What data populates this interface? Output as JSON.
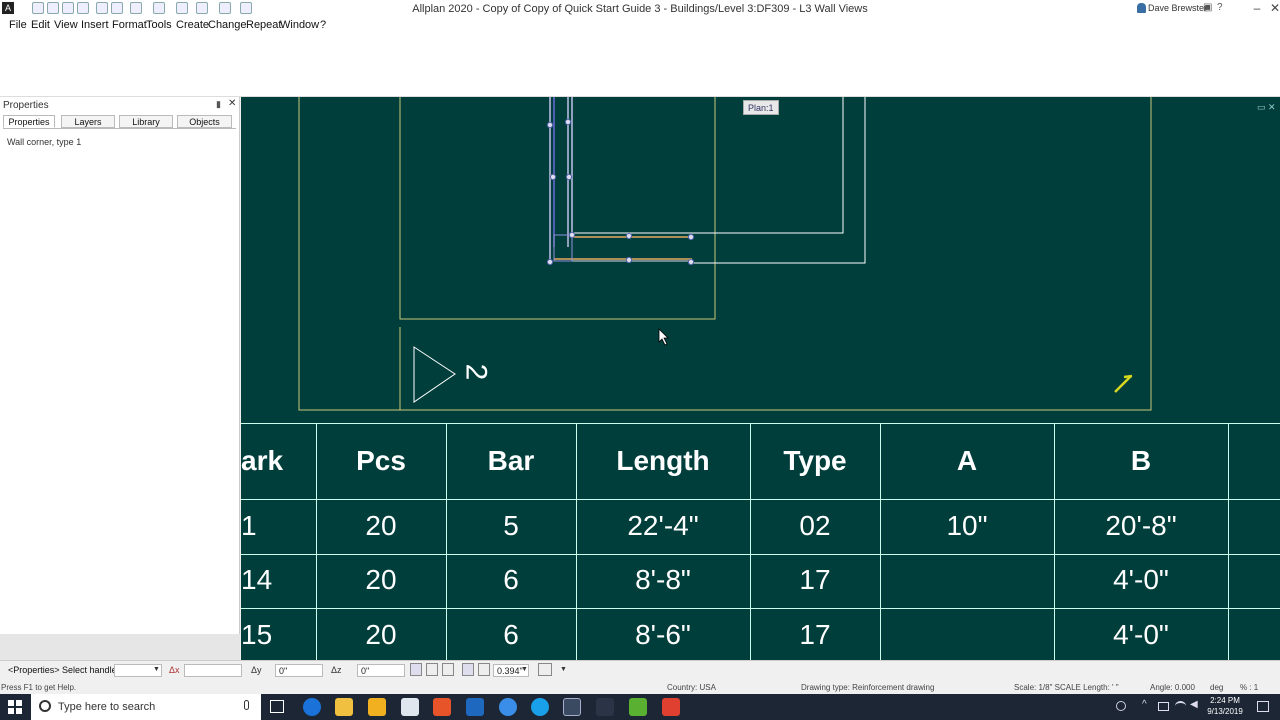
{
  "window": {
    "title": "Allplan 2020 - Copy of Copy of Quick Start Guide 3 - Buildings/Level 3:DF309 - L3 Wall Views",
    "user": "Dave Brewster"
  },
  "menu": [
    "File",
    "Edit",
    "View",
    "Insert",
    "Format",
    "Tools",
    "Create",
    "Change",
    "Repeat",
    "Window",
    "?"
  ],
  "properties_panel": {
    "title": "Properties",
    "tabs": [
      "Properties",
      "Layers",
      "Library",
      "Objects"
    ],
    "active_tab": "Properties",
    "selection": "Wall corner, type 1"
  },
  "canvas": {
    "plan_tag": "Plan:1",
    "section_marker": "2",
    "background_color": "#003e3c"
  },
  "schedule": {
    "headers": [
      "ark",
      "Pcs",
      "Bar",
      "Length",
      "Type",
      "A",
      "B"
    ],
    "rows": [
      [
        "1",
        "20",
        "5",
        "22'-4\"",
        "02",
        "10\"",
        "20'-8\""
      ],
      [
        "14",
        "20",
        "6",
        "8'-8\"",
        "17",
        "",
        "4'-0\""
      ],
      [
        "15",
        "20",
        "6",
        "8'-6\"",
        "17",
        "",
        "4'-0\""
      ]
    ]
  },
  "statusbar": {
    "prompt": "<Properties>  Select handle",
    "dx_label": "Δx",
    "dy_label": "Δy",
    "dz_label": "Δz",
    "dy_value": "0\"",
    "dz_value": "0\"",
    "pen_value": "0.394\""
  },
  "helpbar": {
    "help": "Press F1 to get Help.",
    "country": "Country:  USA",
    "drawing_type": "Drawing type:   Reinforcement drawing",
    "scale": "Scale:  1/8\"  SCALE  Length:  ' \"",
    "angle": "Angle:  0.000",
    "angle_unit": "deg",
    "percent": "% :  1"
  },
  "taskbar": {
    "search_placeholder": "Type here to search",
    "time": "2:24 PM",
    "date": "9/13/2019"
  }
}
